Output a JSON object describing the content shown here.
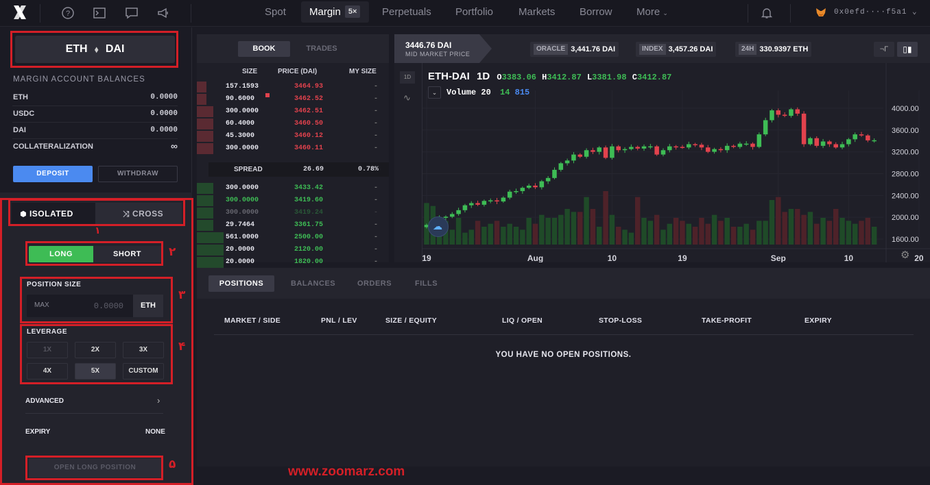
{
  "topbar": {
    "logo_icon": "x-logo-icon",
    "nav": [
      "Spot",
      "Margin",
      "Perpetuals",
      "Portfolio",
      "Markets",
      "Borrow",
      "More"
    ],
    "margin_badge": "5×",
    "wallet": "0x0efd····f5a1"
  },
  "left": {
    "pair_base": "ETH",
    "pair_quote": "DAI",
    "balances_title": "MARGIN ACCOUNT BALANCES",
    "balances": [
      {
        "k": "ETH",
        "v": "0.0000"
      },
      {
        "k": "USDC",
        "v": "0.0000"
      },
      {
        "k": "DAI",
        "v": "0.0000"
      },
      {
        "k": "COLLATERALIZATION",
        "v": "∞"
      }
    ],
    "deposit": "DEPOSIT",
    "withdraw": "WITHDRAW",
    "isolated": "ISOLATED",
    "cross": "CROSS",
    "long": "LONG",
    "short": "SHORT",
    "position_size_label": "POSITION SIZE",
    "max": "MAX",
    "size_placeholder": "0.0000",
    "size_unit": "ETH",
    "leverage_label": "LEVERAGE",
    "leverage": [
      "1X",
      "2X",
      "3X",
      "4X",
      "5X",
      "CUSTOM"
    ],
    "advanced": "ADVANCED",
    "expiry_label": "EXPIRY",
    "expiry_value": "NONE",
    "open_btn": "OPEN LONG POSITION",
    "annot": [
      "١",
      "٢",
      "٣",
      "۴",
      "۵"
    ]
  },
  "book": {
    "tabs": [
      "BOOK",
      "TRADES"
    ],
    "headers": [
      "SIZE",
      "PRICE (DAI)",
      "MY SIZE"
    ],
    "asks": [
      {
        "size": "157.1593",
        "price": "3464.93",
        "my": "-",
        "depth": 0.05
      },
      {
        "size": "90.6000",
        "price": "3462.52",
        "my": "-",
        "depth": 0.05
      },
      {
        "size": "300.0000",
        "price": "3462.51",
        "my": "-",
        "depth": 0.085
      },
      {
        "size": "60.4000",
        "price": "3460.50",
        "my": "-",
        "depth": 0.085
      },
      {
        "size": "45.3000",
        "price": "3460.12",
        "my": "-",
        "depth": 0.085
      },
      {
        "size": "300.0000",
        "price": "3460.11",
        "my": "-",
        "depth": 0.085
      }
    ],
    "spread": {
      "label": "SPREAD",
      "value": "26.69",
      "pct": "0.78%"
    },
    "bids": [
      {
        "size": "300.0000",
        "price": "3433.42",
        "my": "-",
        "depth": 0.085
      },
      {
        "size": "300.0000",
        "price": "3419.60",
        "my": "-",
        "depth": 0.085
      },
      {
        "size": "300.0000",
        "price": "3419.24",
        "my": "-",
        "depth": 0.085
      },
      {
        "size": "29.7464",
        "price": "3361.75",
        "my": "-",
        "depth": 0.085
      },
      {
        "size": "561.0000",
        "price": "2500.00",
        "my": "-",
        "depth": 0.14
      },
      {
        "size": "20.0000",
        "price": "2120.00",
        "my": "-",
        "depth": 0.14
      },
      {
        "size": "20.0000",
        "price": "1820.00",
        "my": "-",
        "depth": 0.14
      }
    ]
  },
  "chart_hdr": {
    "mid_price": "3446.76 DAI",
    "mid_label": "MID MARKET PRICE",
    "oracle_label": "ORACLE",
    "oracle_value": "3,441.76 DAI",
    "index_label": "INDEX",
    "index_value": "3,457.26 DAI",
    "vol_label": "24H",
    "vol_value": "330.9397 ETH"
  },
  "chart_data": {
    "type": "candlestick",
    "symbol": "ETH-DAI",
    "interval": "1D",
    "ohlc_label": {
      "O": "3383.06",
      "H": "3412.87",
      "L": "3381.98",
      "C": "3412.87"
    },
    "volume_label": "Volume",
    "volume_period": "20",
    "volume_values": [
      "14",
      "815"
    ],
    "yticks": [
      "4000.00",
      "3600.00",
      "3200.00",
      "2800.00",
      "2400.00",
      "2000.00",
      "1600.00"
    ],
    "xticks": [
      "19",
      "Aug",
      "10",
      "19",
      "Sep",
      "10",
      "20"
    ],
    "ylim": [
      1500,
      4200
    ],
    "closes": [
      1860,
      1930,
      1990,
      2010,
      2060,
      2130,
      2220,
      2260,
      2230,
      2300,
      2310,
      2290,
      2360,
      2470,
      2480,
      2540,
      2580,
      2550,
      2660,
      2720,
      2870,
      2990,
      3040,
      3150,
      3110,
      3230,
      3200,
      3280,
      3090,
      3300,
      3230,
      3250,
      3290,
      3260,
      3300,
      3300,
      3150,
      3230,
      3300,
      3290,
      3280,
      3340,
      3330,
      3280,
      3200,
      3250,
      3230,
      3310,
      3290,
      3350,
      3350,
      3290,
      3520,
      3780,
      3960,
      3880,
      3860,
      3980,
      3900,
      3340,
      3450,
      3310,
      3390,
      3340,
      3280,
      3340,
      3430,
      3520,
      3500,
      3410,
      3412
    ],
    "volumes": [
      14,
      13,
      6,
      8,
      5,
      9,
      4,
      5,
      8,
      6,
      7,
      8,
      6,
      7,
      6,
      5,
      9,
      7,
      10,
      9,
      9,
      10,
      12,
      11,
      11,
      16,
      12,
      6,
      18,
      10,
      6,
      5,
      4,
      16,
      9,
      8,
      10,
      5,
      7,
      9,
      8,
      7,
      6,
      9,
      7,
      10,
      8,
      9,
      6,
      6,
      7,
      5,
      8,
      8,
      15,
      16,
      11,
      12,
      12,
      10,
      11,
      7,
      9,
      8,
      12,
      9,
      8,
      7,
      8,
      9,
      6
    ]
  },
  "positions": {
    "tabs": [
      "POSITIONS",
      "BALANCES",
      "ORDERS",
      "FILLS"
    ],
    "columns": [
      "MARKET / SIDE",
      "PNL / LEV",
      "SIZE / EQUITY",
      "LIQ / OPEN",
      "STOP-LOSS",
      "TAKE-PROFIT",
      "EXPIRY"
    ],
    "empty": "YOU HAVE NO OPEN POSITIONS."
  },
  "watermark": "www.zoomarz.com",
  "colors": {
    "red": "#e2424d",
    "green": "#3ebc55",
    "annotation": "#d41f27",
    "accent": "#4b8af0"
  }
}
